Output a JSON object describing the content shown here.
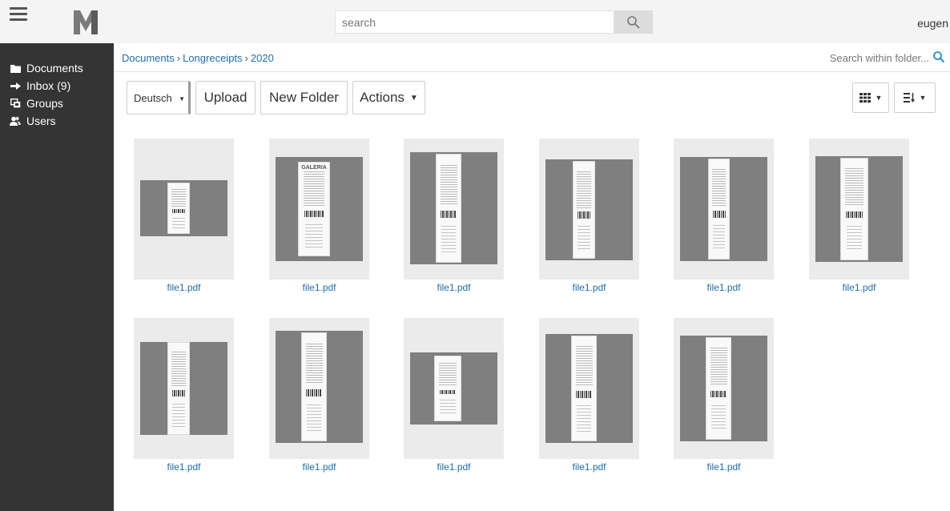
{
  "header": {
    "search_placeholder": "search",
    "user": "eugen"
  },
  "sidebar": {
    "items": [
      {
        "label": "Documents",
        "icon": "folder-icon"
      },
      {
        "label": "Inbox (9)",
        "icon": "arrow-right-icon"
      },
      {
        "label": "Groups",
        "icon": "groups-icon"
      },
      {
        "label": "Users",
        "icon": "users-icon"
      }
    ]
  },
  "breadcrumb": {
    "items": [
      "Documents",
      "Longreceipts",
      "2020"
    ],
    "separator": "›"
  },
  "folder_search": {
    "placeholder": "Search within folder..."
  },
  "toolbar": {
    "language": "Deutsch",
    "upload_label": "Upload",
    "new_folder_label": "New Folder",
    "actions_label": "Actions"
  },
  "documents": [
    {
      "name": "file1.pdf",
      "brand": ""
    },
    {
      "name": "file1.pdf",
      "brand": "GALERIA"
    },
    {
      "name": "file1.pdf",
      "brand": ""
    },
    {
      "name": "file1.pdf",
      "brand": ""
    },
    {
      "name": "file1.pdf",
      "brand": ""
    },
    {
      "name": "file1.pdf",
      "brand": ""
    },
    {
      "name": "file1.pdf",
      "brand": ""
    },
    {
      "name": "file1.pdf",
      "brand": ""
    },
    {
      "name": "file1.pdf",
      "brand": ""
    },
    {
      "name": "file1.pdf",
      "brand": ""
    },
    {
      "name": "file1.pdf",
      "brand": ""
    }
  ],
  "colors": {
    "sidebar_bg": "#343434",
    "link": "#1f6ea8",
    "header_bg": "#f4f4f4"
  }
}
